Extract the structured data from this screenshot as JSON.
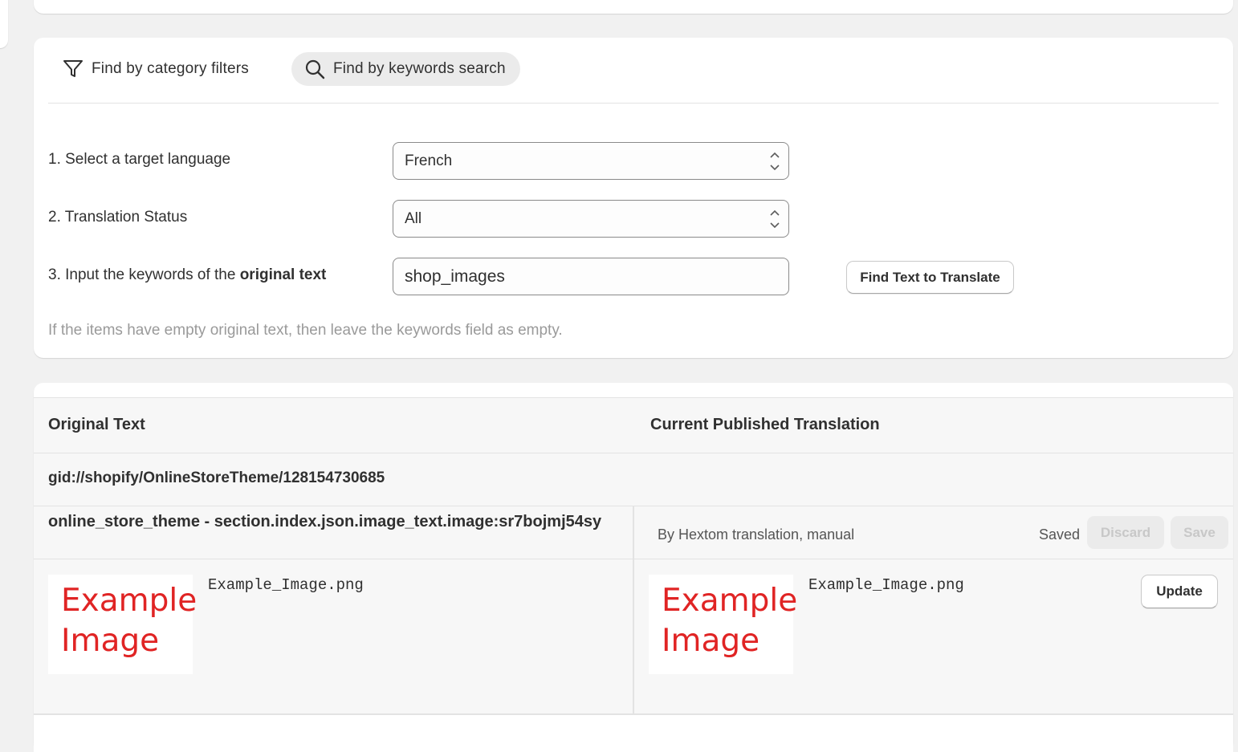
{
  "tabs": {
    "category_label": "Find by category filters",
    "keywords_label": "Find by keywords search"
  },
  "form": {
    "language_label": "1. Select a target language",
    "language_value": "French",
    "status_label": "2. Translation Status",
    "status_value": "All",
    "keywords_label_prefix": "3. Input the keywords of the ",
    "keywords_label_bold": "original text",
    "keywords_value": "shop_images",
    "find_button": "Find Text to Translate",
    "hint": "If the items have empty original text, then leave the keywords field as empty."
  },
  "table": {
    "col_original": "Original Text",
    "col_translation": "Current Published Translation",
    "gid": "gid://shopify/OnlineStoreTheme/128154730685",
    "key": "online_store_theme - section.index.json.image_text.image:sr7bojmj54sy",
    "by_text": "By Hextom translation, manual",
    "status": "Saved",
    "discard_button": "Discard",
    "save_button": "Save",
    "update_button": "Update",
    "original_image": {
      "line1": "Example",
      "line2": "Image",
      "filename": "Example_Image.png"
    },
    "translated_image": {
      "line1": "Example",
      "line2": "Image",
      "filename": "Example_Image.png"
    }
  },
  "colors": {
    "image_text": "#e02424",
    "hint": "#9a9a9a",
    "tab_active_bg": "#ebebeb"
  }
}
